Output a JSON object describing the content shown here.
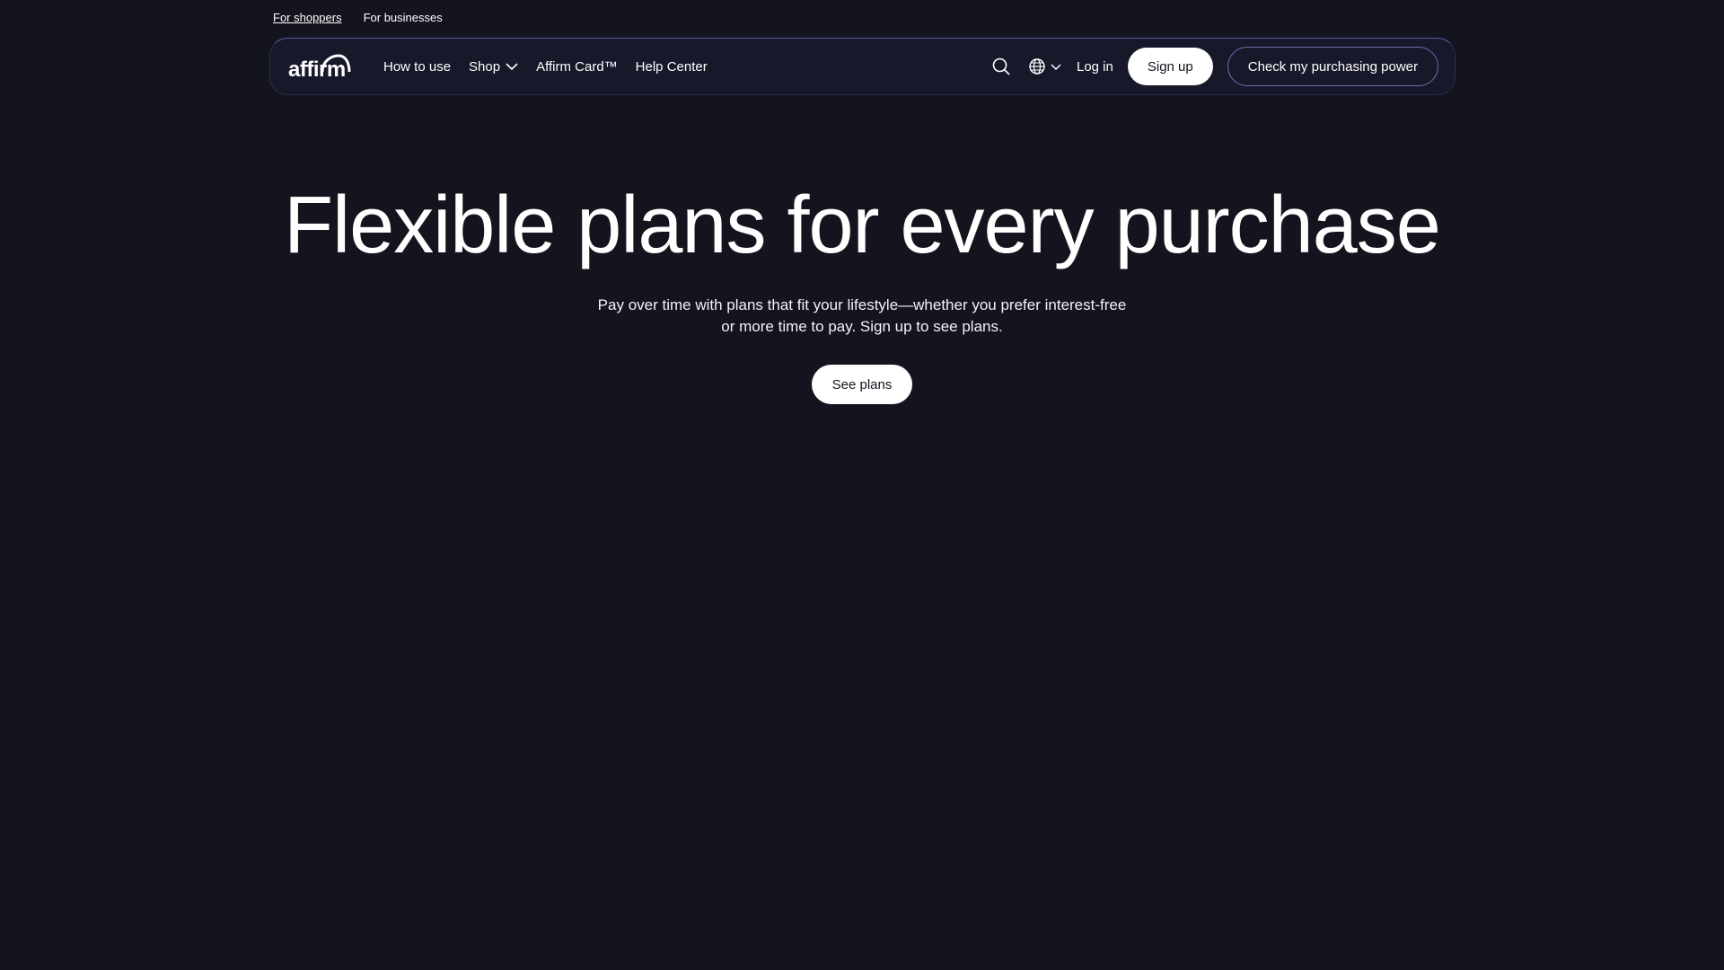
{
  "top_links": {
    "shoppers": "For shoppers",
    "businesses": "For businesses"
  },
  "nav": {
    "logo_text": "affirm",
    "items": [
      {
        "label": "How to use"
      },
      {
        "label": "Shop"
      },
      {
        "label": "Affirm Card™"
      },
      {
        "label": "Help Center"
      }
    ],
    "login": "Log in",
    "signup": "Sign up",
    "check_power": "Check my purchasing power"
  },
  "hero": {
    "title": "Flexible plans for every purchase",
    "subtitle": "Pay over time with plans that fit your lifestyle—whether you prefer interest-free or more time to pay. Sign up to see plans.",
    "cta": "See plans"
  },
  "icons": {
    "search": "search-icon",
    "globe": "globe-icon",
    "chevron": "chevron-down-icon"
  },
  "colors": {
    "background": "#14141f",
    "nav_background": "#171829",
    "accent_border": "#6a6fb0",
    "button_bg": "#ffffff"
  }
}
